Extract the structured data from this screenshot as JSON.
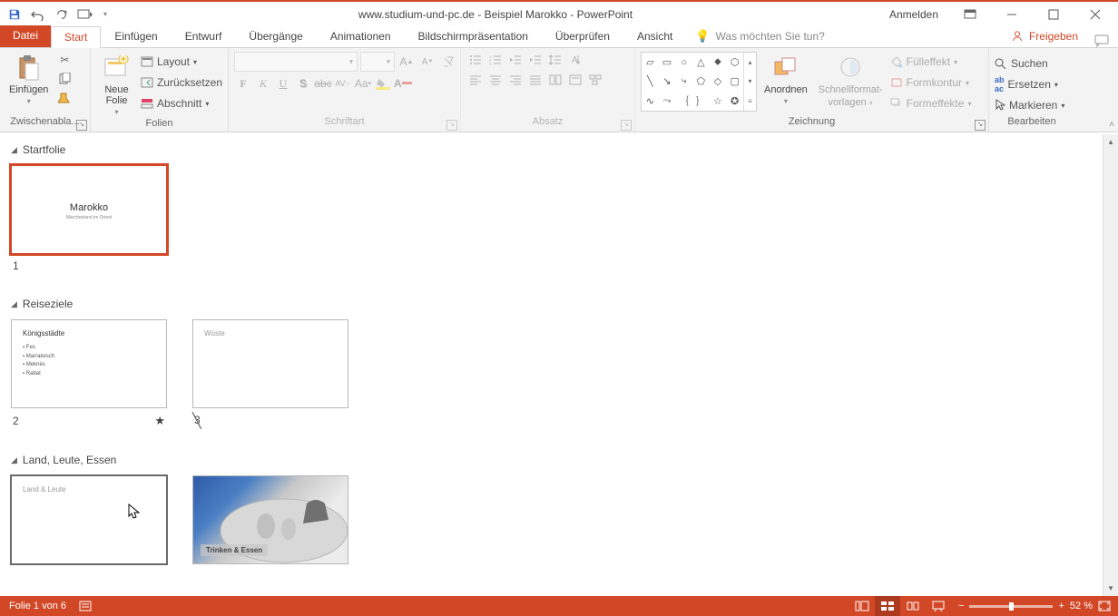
{
  "title_center": "www.studium-und-pc.de - Beispiel Marokko  -  PowerPoint",
  "signin": "Anmelden",
  "tabs": {
    "file": "Datei",
    "home": "Start",
    "insert": "Einfügen",
    "design": "Entwurf",
    "transitions": "Übergänge",
    "animations": "Animationen",
    "slideshow": "Bildschirmpräsentation",
    "review": "Überprüfen",
    "view": "Ansicht"
  },
  "tellme_placeholder": "Was möchten Sie tun?",
  "share": "Freigeben",
  "ribbon": {
    "clipboard": {
      "label": "Zwischenabla...",
      "paste": "Einfügen"
    },
    "slides": {
      "label": "Folien",
      "newslide": "Neue Folie",
      "layout": "Layout",
      "reset": "Zurücksetzen",
      "section": "Abschnitt"
    },
    "font": {
      "label": "Schriftart"
    },
    "paragraph": {
      "label": "Absatz"
    },
    "drawing": {
      "label": "Zeichnung",
      "arrange": "Anordnen",
      "quickstyles_l1": "Schnellformat-",
      "quickstyles_l2": "vorlagen",
      "fill": "Fülleffekt",
      "outline": "Formkontur",
      "effects": "Formeffekte"
    },
    "editing": {
      "label": "Bearbeiten",
      "find": "Suchen",
      "replace": "Ersetzen",
      "select": "Markieren"
    }
  },
  "sections": [
    {
      "name": "Startfolie",
      "slides": [
        {
          "num": "1",
          "selected": true,
          "title": "Marokko",
          "subtitle": "Märchenland im Orient"
        }
      ]
    },
    {
      "name": "Reiseziele",
      "slides": [
        {
          "num": "2",
          "title": "Königsstädte",
          "bullets": [
            "Fes",
            "Marrakesch",
            "Meknès",
            "Rabat"
          ],
          "star": true
        },
        {
          "num": "3",
          "title": "Wüste",
          "hidden": true
        }
      ]
    },
    {
      "name": "Land, Leute, Essen",
      "slides": [
        {
          "num": "",
          "title": "Land & Leute",
          "darksel": true
        },
        {
          "num": "",
          "caption": "Trinken & Essen",
          "photo": true
        }
      ]
    }
  ],
  "status": {
    "slide_of": "Folie 1 von 6",
    "zoom": "52 %"
  }
}
